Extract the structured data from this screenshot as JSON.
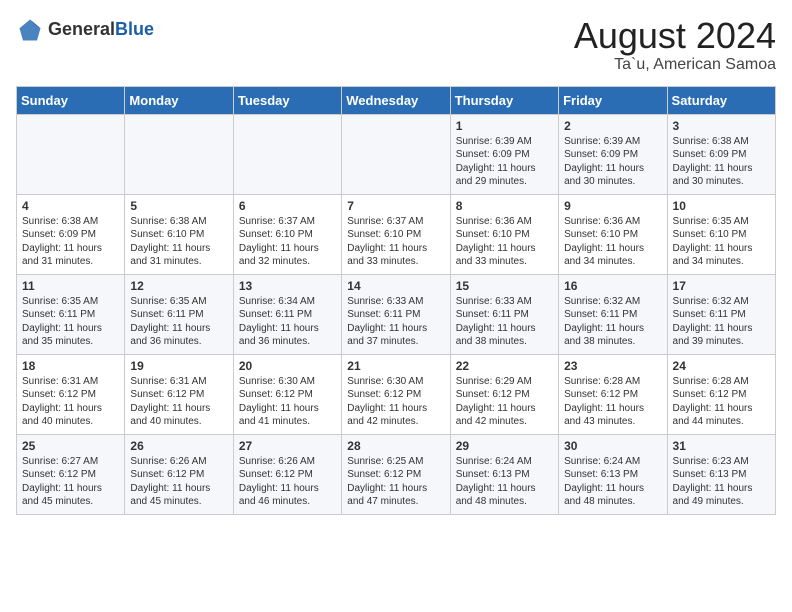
{
  "header": {
    "logo_general": "General",
    "logo_blue": "Blue",
    "title": "August 2024",
    "subtitle": "Ta`u, American Samoa"
  },
  "days_of_week": [
    "Sunday",
    "Monday",
    "Tuesday",
    "Wednesday",
    "Thursday",
    "Friday",
    "Saturday"
  ],
  "weeks": [
    [
      {
        "day": "",
        "info": ""
      },
      {
        "day": "",
        "info": ""
      },
      {
        "day": "",
        "info": ""
      },
      {
        "day": "",
        "info": ""
      },
      {
        "day": "1",
        "info": "Sunrise: 6:39 AM\nSunset: 6:09 PM\nDaylight: 11 hours and 29 minutes."
      },
      {
        "day": "2",
        "info": "Sunrise: 6:39 AM\nSunset: 6:09 PM\nDaylight: 11 hours and 30 minutes."
      },
      {
        "day": "3",
        "info": "Sunrise: 6:38 AM\nSunset: 6:09 PM\nDaylight: 11 hours and 30 minutes."
      }
    ],
    [
      {
        "day": "4",
        "info": "Sunrise: 6:38 AM\nSunset: 6:09 PM\nDaylight: 11 hours and 31 minutes."
      },
      {
        "day": "5",
        "info": "Sunrise: 6:38 AM\nSunset: 6:10 PM\nDaylight: 11 hours and 31 minutes."
      },
      {
        "day": "6",
        "info": "Sunrise: 6:37 AM\nSunset: 6:10 PM\nDaylight: 11 hours and 32 minutes."
      },
      {
        "day": "7",
        "info": "Sunrise: 6:37 AM\nSunset: 6:10 PM\nDaylight: 11 hours and 33 minutes."
      },
      {
        "day": "8",
        "info": "Sunrise: 6:36 AM\nSunset: 6:10 PM\nDaylight: 11 hours and 33 minutes."
      },
      {
        "day": "9",
        "info": "Sunrise: 6:36 AM\nSunset: 6:10 PM\nDaylight: 11 hours and 34 minutes."
      },
      {
        "day": "10",
        "info": "Sunrise: 6:35 AM\nSunset: 6:10 PM\nDaylight: 11 hours and 34 minutes."
      }
    ],
    [
      {
        "day": "11",
        "info": "Sunrise: 6:35 AM\nSunset: 6:11 PM\nDaylight: 11 hours and 35 minutes."
      },
      {
        "day": "12",
        "info": "Sunrise: 6:35 AM\nSunset: 6:11 PM\nDaylight: 11 hours and 36 minutes."
      },
      {
        "day": "13",
        "info": "Sunrise: 6:34 AM\nSunset: 6:11 PM\nDaylight: 11 hours and 36 minutes."
      },
      {
        "day": "14",
        "info": "Sunrise: 6:33 AM\nSunset: 6:11 PM\nDaylight: 11 hours and 37 minutes."
      },
      {
        "day": "15",
        "info": "Sunrise: 6:33 AM\nSunset: 6:11 PM\nDaylight: 11 hours and 38 minutes."
      },
      {
        "day": "16",
        "info": "Sunrise: 6:32 AM\nSunset: 6:11 PM\nDaylight: 11 hours and 38 minutes."
      },
      {
        "day": "17",
        "info": "Sunrise: 6:32 AM\nSunset: 6:11 PM\nDaylight: 11 hours and 39 minutes."
      }
    ],
    [
      {
        "day": "18",
        "info": "Sunrise: 6:31 AM\nSunset: 6:12 PM\nDaylight: 11 hours and 40 minutes."
      },
      {
        "day": "19",
        "info": "Sunrise: 6:31 AM\nSunset: 6:12 PM\nDaylight: 11 hours and 40 minutes."
      },
      {
        "day": "20",
        "info": "Sunrise: 6:30 AM\nSunset: 6:12 PM\nDaylight: 11 hours and 41 minutes."
      },
      {
        "day": "21",
        "info": "Sunrise: 6:30 AM\nSunset: 6:12 PM\nDaylight: 11 hours and 42 minutes."
      },
      {
        "day": "22",
        "info": "Sunrise: 6:29 AM\nSunset: 6:12 PM\nDaylight: 11 hours and 42 minutes."
      },
      {
        "day": "23",
        "info": "Sunrise: 6:28 AM\nSunset: 6:12 PM\nDaylight: 11 hours and 43 minutes."
      },
      {
        "day": "24",
        "info": "Sunrise: 6:28 AM\nSunset: 6:12 PM\nDaylight: 11 hours and 44 minutes."
      }
    ],
    [
      {
        "day": "25",
        "info": "Sunrise: 6:27 AM\nSunset: 6:12 PM\nDaylight: 11 hours and 45 minutes."
      },
      {
        "day": "26",
        "info": "Sunrise: 6:26 AM\nSunset: 6:12 PM\nDaylight: 11 hours and 45 minutes."
      },
      {
        "day": "27",
        "info": "Sunrise: 6:26 AM\nSunset: 6:12 PM\nDaylight: 11 hours and 46 minutes."
      },
      {
        "day": "28",
        "info": "Sunrise: 6:25 AM\nSunset: 6:12 PM\nDaylight: 11 hours and 47 minutes."
      },
      {
        "day": "29",
        "info": "Sunrise: 6:24 AM\nSunset: 6:13 PM\nDaylight: 11 hours and 48 minutes."
      },
      {
        "day": "30",
        "info": "Sunrise: 6:24 AM\nSunset: 6:13 PM\nDaylight: 11 hours and 48 minutes."
      },
      {
        "day": "31",
        "info": "Sunrise: 6:23 AM\nSunset: 6:13 PM\nDaylight: 11 hours and 49 minutes."
      }
    ]
  ]
}
